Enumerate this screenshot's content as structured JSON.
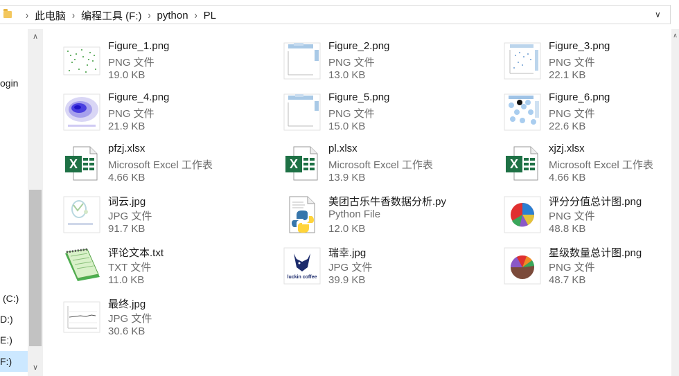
{
  "address": {
    "folder_icon": "folder-icon",
    "crumbs": [
      "此电脑",
      "编程工具 (F:)",
      "python",
      "PL"
    ],
    "dropdown_icon": "chevron-down-icon"
  },
  "nav": {
    "items": [
      "ogin",
      "(C:)",
      "D:)",
      "E:)",
      "F:)"
    ]
  },
  "files": [
    {
      "name": "Figure_1.png",
      "type": "PNG 文件",
      "size": "19.0 KB",
      "icon": "scatter-plot-thumbnail"
    },
    {
      "name": "Figure_2.png",
      "type": "PNG 文件",
      "size": "13.0 KB",
      "icon": "histogram-plot-thumbnail"
    },
    {
      "name": "Figure_3.png",
      "type": "PNG 文件",
      "size": "22.1 KB",
      "icon": "jointplot-thumbnail"
    },
    {
      "name": "Figure_4.png",
      "type": "PNG 文件",
      "size": "21.9 KB",
      "icon": "kde-plot-thumbnail"
    },
    {
      "name": "Figure_5.png",
      "type": "PNG 文件",
      "size": "15.0 KB",
      "icon": "histogram-plot-thumbnail"
    },
    {
      "name": "Figure_6.png",
      "type": "PNG 文件",
      "size": "22.6 KB",
      "icon": "hexbin-plot-thumbnail"
    },
    {
      "name": "pfzj.xlsx",
      "type": "Microsoft Excel 工作表",
      "size": "4.66 KB",
      "icon": "excel-icon"
    },
    {
      "name": "pl.xlsx",
      "type": "Microsoft Excel 工作表",
      "size": "13.9 KB",
      "icon": "excel-icon"
    },
    {
      "name": "xjzj.xlsx",
      "type": "Microsoft Excel 工作表",
      "size": "4.66 KB",
      "icon": "excel-icon"
    },
    {
      "name": "词云.jpg",
      "type": "JPG 文件",
      "size": "91.7 KB",
      "icon": "wordcloud-thumbnail"
    },
    {
      "name": "美团古乐牛香数据分析.py",
      "type": "Python File",
      "size": "12.0 KB",
      "icon": "python-icon"
    },
    {
      "name": "评分分值总计图.png",
      "type": "PNG 文件",
      "size": "48.8 KB",
      "icon": "pie-chart-thumbnail"
    },
    {
      "name": "评论文本.txt",
      "type": "TXT 文件",
      "size": "11.0 KB",
      "icon": "notepad-icon"
    },
    {
      "name": "瑞幸.jpg",
      "type": "JPG 文件",
      "size": "39.9 KB",
      "icon": "luckin-logo-thumbnail"
    },
    {
      "name": "星级数量总计图.png",
      "type": "PNG 文件",
      "size": "48.7 KB",
      "icon": "pie-chart-thumbnail"
    },
    {
      "name": "最终.jpg",
      "type": "JPG 文件",
      "size": "30.6 KB",
      "icon": "line-chart-thumbnail"
    }
  ],
  "thumb_text": {
    "luckin": "luckin coffee",
    "excel_letter": "X"
  },
  "colors": {
    "excel_green": "#1e7145",
    "python_blue": "#3776ab",
    "python_yellow": "#ffd43b",
    "selected_nav": "#cce8ff"
  }
}
